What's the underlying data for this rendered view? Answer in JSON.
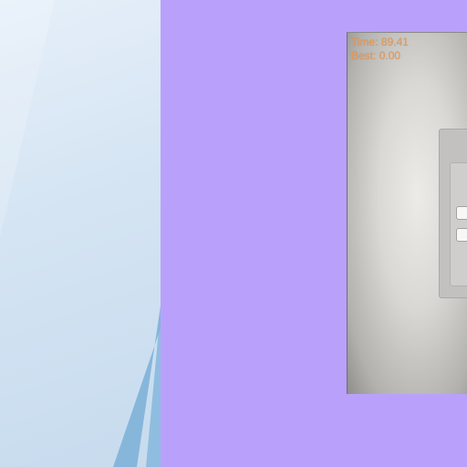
{
  "hud": {
    "time_label": "Time:",
    "time_value": "89.41",
    "best_label": "Best:",
    "best_value": "0.00"
  },
  "colors": {
    "app_background": "#b9a1fb",
    "hud_text": "#e3995a",
    "wallpaper_accent": "#7fb1d8"
  }
}
